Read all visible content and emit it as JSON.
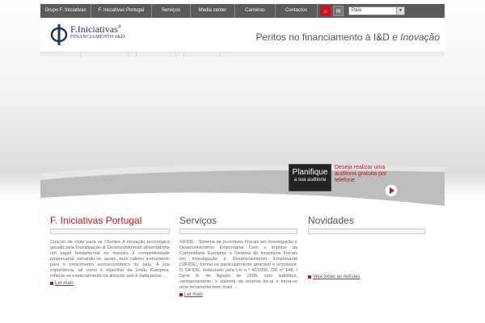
{
  "nav": {
    "items": [
      "Grupo F. Iniciativas",
      "F. Iniciativas Portugal",
      "Serviços",
      "Media center",
      "Carreiras",
      "Contactos"
    ],
    "country_select": "País"
  },
  "header": {
    "logo_name": "F.Iniciativas",
    "logo_reg": "®",
    "logo_sub": "FINANCIAMENTO I&D",
    "tagline_plain": "Peritos no financiamento à I&D ",
    "tagline_italic": "e Inovação"
  },
  "banner": {
    "cta_title": "Planifique",
    "cta_subtitle": "a sua auditoria",
    "cta_text": "Deseja realizar uma auditoria gratuita por telefone"
  },
  "columns": [
    {
      "title_prefix": "F. ",
      "title_main": "Iniciativas Portugal",
      "text": "Criação de Valor para os Clientes A inovação tecnológica gerada pela Investigação & Desenvolvimento desempenha um papel fundamental no impulso à competitividade empresarial, tornando-se, assim, num valioso instrumento para o crescimento socioeconómico do país. A sua importância, tal como é objectivo da União Europeia, reflecte-se especialmente na atenção que é dada pelos ...",
      "more": "Ler mais"
    },
    {
      "title": "Serviços",
      "text": "SIFIDE - Sistema de Incentivos Fiscais em Investigação e Desenvolvimento Empresarial Com o impulso da Comunidade Europeia, o Sistema de Incentivos Fiscais em Investigação e Desenvolvimento Empresarial (SIFIDE), tornou-se particularmente atractivo e promissor. O SIFIDE, instaurado pela Lei n.º 40/2005, DR nº 148, I Série A, de Agosto de 2005, veio substituir, vantajosamente, o sistema da reserva fiscal e torna-se uma ferramenta bem mais ...",
      "more": "Ler mais"
    },
    {
      "title": "Novidades",
      "more": "Veja todas as notícias"
    }
  ],
  "colors": {
    "accent": "#c4161c",
    "brand": "#1e3566",
    "nav_bg": "#5a5a5a"
  },
  "icons": [
    "home-icon",
    "mail-icon",
    "chevron-down-icon",
    "play-arrow-icon",
    "bullet-icon"
  ]
}
